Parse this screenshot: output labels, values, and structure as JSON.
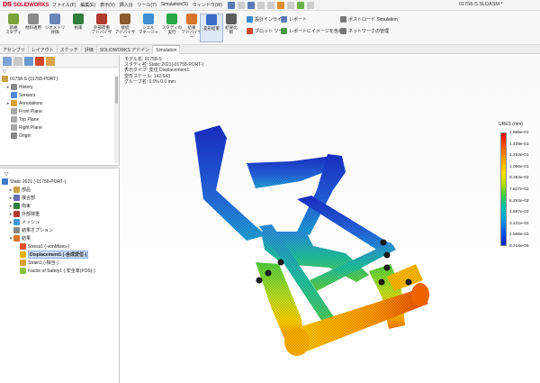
{
  "app": {
    "logo_text": "SOLIDWORKS",
    "doc_title": "01758-S.SLDASM *"
  },
  "menu": [
    "ファイル(F)",
    "編集(E)",
    "表示(V)",
    "挿入(I)",
    "ツール(T)",
    "Simulation(S)",
    "ウィンドウ(W)"
  ],
  "commands": {
    "large": [
      {
        "label": "新規\nスタディ",
        "color": "#7aa33b"
      },
      {
        "label": "材料適用",
        "color": "#8a8a8a"
      },
      {
        "label": "ジオメトリ\n評価",
        "color": "#6a86b8"
      },
      {
        "label": "拘束",
        "color": "#2f7d3a"
      },
      {
        "label": "外部荷重\nアドバイザー",
        "color": "#b03a2e"
      },
      {
        "label": "接続\nアドバイザー",
        "color": "#8c5a2b"
      },
      {
        "label": "シェル\nマネージャ",
        "color": "#3d8fd1"
      },
      {
        "label": "スタディの\n実行",
        "color": "#27a844"
      },
      {
        "label": "結果\nアドバイザー",
        "color": "#d8742b"
      },
      {
        "label": "変形結果",
        "color": "#3a6bc4"
      },
      {
        "label": "結果比\n較",
        "color": "#5b5b5b"
      }
    ],
    "small": [
      {
        "label": "設計インサイト",
        "color": "#3a8ad1"
      },
      {
        "label": "プロット ツール",
        "color": "#d04a2a"
      },
      {
        "label": "レポート",
        "color": "#5a7bb5"
      },
      {
        "label": "レポートにイメージを含める",
        "color": "#4a9a4a"
      },
      {
        "label": "ポストロード Simulation",
        "color": "#777777"
      },
      {
        "label": "ネットワークの管理",
        "color": "#777777"
      }
    ]
  },
  "cm_tabs": [
    {
      "label": "アセンブリ",
      "active": false
    },
    {
      "label": "レイアウト",
      "active": false
    },
    {
      "label": "スケッチ",
      "active": false
    },
    {
      "label": "評価",
      "active": false
    },
    {
      "label": "SOLIDWORKS アドイン",
      "active": false
    },
    {
      "label": "Simulation",
      "active": true
    }
  ],
  "feature_tree": {
    "root": "01758-S (01758-PORT)",
    "items": [
      {
        "label": "History",
        "arrow": "▸"
      },
      {
        "label": "Sensors",
        "arrow": ""
      },
      {
        "label": "Annotations",
        "arrow": "▸"
      },
      {
        "label": "Front Plane",
        "arrow": ""
      },
      {
        "label": "Top Plane",
        "arrow": ""
      },
      {
        "label": "Right Plane",
        "arrow": ""
      },
      {
        "label": "Origin",
        "arrow": ""
      }
    ]
  },
  "study_tree": {
    "root": "Static 2021 (-01758-PORT-)",
    "items": [
      {
        "label": "部品",
        "arrow": "▸",
        "indent": 1
      },
      {
        "label": "接合部",
        "arrow": "▸",
        "indent": 1
      },
      {
        "label": "拘束",
        "arrow": "▸",
        "indent": 1
      },
      {
        "label": "外部荷重",
        "arrow": "▸",
        "indent": 1
      },
      {
        "label": "メッシュ",
        "arrow": "▸",
        "indent": 1
      },
      {
        "label": "結果オプション",
        "arrow": "",
        "indent": 1
      },
      {
        "label": "結果",
        "arrow": "▾",
        "indent": 1
      },
      {
        "label": "Stress1 (-vonMises-)",
        "arrow": "",
        "indent": 2
      },
      {
        "label": "Displacement1 (-合成変位-)",
        "arrow": "",
        "indent": 2,
        "selected": true
      },
      {
        "label": "Strain1 (-相当-)",
        "arrow": "",
        "indent": 2
      },
      {
        "label": "Factor of Safety1 (-安全率(FOS)-)",
        "arrow": "",
        "indent": 2
      }
    ]
  },
  "viewport_info": [
    "モデル名: 01758-S",
    "スタディ名: Static 2021(-01758-PORT-)",
    "表示タイプ: 変位 Displacement1",
    "変形スケール: 142.643",
    "グループ名: 0.0% 0.0 mm"
  ],
  "legend": {
    "title": "URES (mm)",
    "ticks": [
      "1.565e-01",
      "1.409e-01",
      "1.252e-01",
      "1.096e-01",
      "9.392e-02",
      "7.827e-02",
      "6.262e-02",
      "4.697e-02",
      "3.131e-02",
      "1.566e-02",
      "8.216e-06"
    ]
  }
}
